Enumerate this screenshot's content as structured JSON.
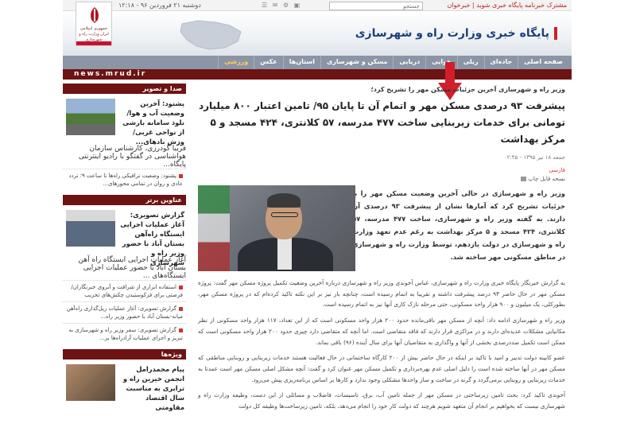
{
  "topbar": {
    "date": "دوشنبه ۲۱ فروردین ۹۶  -  ۱۲:۱۸",
    "search_placeholder": "جستجو",
    "tools": "☰ ✉ ⚙ ▣",
    "links": "مشترک خبرنامه پایگاه خبری شوید  |  خبرخوان"
  },
  "header": {
    "site_title": "پایگاه خبری وزارت راه و شهرسازی",
    "logo_text": "جمهوری اسلامی ایران وزارت راه و شهرسازی"
  },
  "nav": {
    "items": [
      "صفحه اصلی",
      "جاده‌ای",
      "ریلی",
      "هوایی",
      "دریایی",
      "مسکن و شهرسازی",
      "استان‌ها",
      "عکس",
      "ورزشی"
    ]
  },
  "url": "news.mrud.ir",
  "article": {
    "kicker": "وزیر راه و شهرسازی آخرین جزئیات مسکن مهر را تشریح کرد؛",
    "headline": "پیشرفت ۹۳ درصدی مسکن مهر و اتمام آن تا پایان ۹۵/ تامین اعتبار ۸۰۰ میلیارد تومانی برای خدمات زیربنایی ساخت ۴۷۷ مدرسه، ۵۷ کلانتری، ۴۲۴ مسجد و ۵ مرکز بهداشت",
    "meta": "جمعه ۱۸ تیر ۱۳۹۵ - ۰۲:۴۵",
    "tags": "فارسی",
    "print": "نسخه قابل چاپ",
    "lead": "وزیر راه و شهرسازی در حالی آخرین وضعیت مسکن مهر را با جزئیات تشریح کرد که آمارها نشان از پیشرفت ۹۳ درصدی آن دارند. به گفته وزیر راه و شهرسازی، ساخت ۴۷۷ مدرسه، ۵۷ کلانتری، ۴۲۴ مسجد و ۵ مرکز بهداشت به رغم عدم تعهد وزارت راه و شهرسازی در دولت یازدهم، توسط وزارت راه و شهرسازی در مناطق مسکونی مهر ساخته شد.",
    "paragraphs": [
      "به گزارش خبرنگار پایگاه خبری وزارت راه و شهرسازی، عباس آخوندی وزیر راه و شهرسازی درباره آخرین وضعیت تکمیل پروژه مسکن مهر گفت: پروژه مسکن مهر در حال حاضر ۹۳ درصد پیشرفت داشته و تقریبا به اتمام رسیده است، چنانچه بار نیز بر این نکته تاکید کرده‌ام که در پروژه مسکن مهر، بطورکلی، یک میلیون و ۹۰۰ هزار واحد مسکونی، حتی مرحله نازک کاری آنها نیز به اتمام رسیده است.",
      "وزیر راه و شهرسازی ادامه داد: آنچه از مسکن مهر باقی‌مانده حدود ۲۰۰ هزار واحد مسکونی است که از این تعداد، ۱۱۷ هزار واحد مسکونی از نظر مکانیابی مشکلات عدیده‌ای دارند و در مراکزی قرار دارند که فاقد متقاضی است. اما آنچه که متقاضی دارد چیزی حدود ۲۰۰ هزار واحد مسکونی است که ممکن است تکمیل صددرصدی بخشی از آنها و واگذاری به متقاضیان آنها برای سال آینده (۹۶) باقی بماند.",
      "عضو کابینه دولت تدبیر و امید با تاکید بر اینکه در حال حاضر بیش از ۲۰۰ کارگاه ساختمانی در حال فعالیت هستند خدمات زیربنایی و روبنایی مناطقی که مسکن مهر در آنها ساخته شده است را دلیل اصلی عدم بهره‌برداری و تکمیل مسکن مهر عنوان کرد و گفت: آنچه مشکل اصلی مسکن مهر است عمدتا به خدمات زیربنایی و روبنایی برمی‌گردد و گرنه در ساخت و ساز واحدها مشکلی وجود ندارد و کارها بر اساس برنامه‌ریزی پیش می‌رود.",
      "آخوندی تاکید کرد: بحث تامین زیرساختی در مسکن مهر از جمله تامین آب، برق، تاسیسات، فاضلاب و مسائلی از این دست، وظیفه وزارت راه و شهرسازی نیست که بخواهیم بر انجام آن متعهد شویم هرچند که دولت کار خود را انجام می‌دهد، بلکه، تامین زیرساخت‌ها وظیفه کل دولت"
    ]
  },
  "sidebar": {
    "box1_title": "صدا و تصویر",
    "box1_feature_title": "پشنود: آخرین وضعیت آب و هوا/ نلوذ سامانه بارشی از نواحی غربی/ وزش بادهای...",
    "box1_feature_sub": "فریبا گودرزی، کارشناس سازمان هواشناسی در گفتگو با رادیو اینترنتی پایگاه...",
    "box1_item": "پشنود: وضعیت ترافیکی راه‌ها تا ساعت ۹؛ تردد عادی و روان در تمامی محورهای...",
    "box2_title": "عناوین برتر",
    "box2_feature_title": "گزارش تصویری: آغاز عملیات اجرایی ایستگاه راه‌آهن بستان آباد با حضور وزیر راه و شهرسازی",
    "box2_feature_sub": "آغاز عملیات اجرایی ایستگاه راه آهن بستان آباد با حضور عملیات اجرایی ایستگاه‌های ...",
    "box2_items": [
      "استفاده ابزاری از شرافت و آبروی خبرنگاران/ فرصتی برای فرکوستیدن چکش‌های تخریب",
      "گزارش تصویری: آغاز عملیات ریل‌گذاری راه‌آهن میانه-بستان آباد با حضور وزیر راه...",
      "گزارش تصویری: سفر وزیر راه و شهرسازی به تبریز و اجرای عملیات آزادراه‌ها بر..."
    ],
    "box3_title": "ویژه‌ها",
    "box3_feature_title": "پیام محمدرامل انجمن خیرین راه و ترابری به مناسبت سال اقتصاد مقاومتی"
  },
  "colors": {
    "maroon": "#6d1313",
    "nav": "#8b95a5",
    "title_blue": "#1c3f7a",
    "arrow_red": "#d01f2a"
  }
}
